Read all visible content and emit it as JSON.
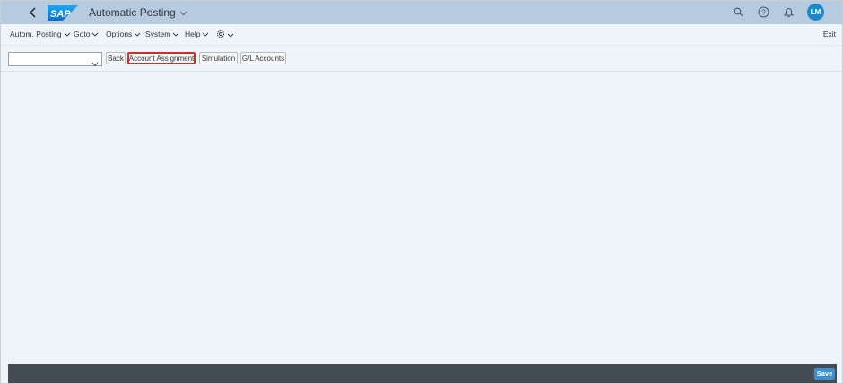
{
  "shell": {
    "logo_text": "SAP",
    "app_title": "Automatic Posting",
    "avatar_initials": "LM",
    "icons": [
      "back-icon",
      "search-icon",
      "help-icon",
      "bell-icon"
    ]
  },
  "menubar": {
    "items": [
      {
        "label": "Autom. Posting"
      },
      {
        "label": "Goto"
      },
      {
        "label": "Options"
      },
      {
        "label": "System"
      },
      {
        "label": "Help"
      }
    ],
    "settings_icon": "gear-icon",
    "exit_label": "Exit"
  },
  "toolbar": {
    "dropdown_value": "",
    "buttons": [
      {
        "label": "Back"
      },
      {
        "label": "Account Assignment",
        "highlighted": true
      },
      {
        "label": "Simulation"
      },
      {
        "label": "G/L Accounts"
      }
    ]
  },
  "footer": {
    "save_label": "Save"
  },
  "colors": {
    "shell_bg": "#b7cbe0",
    "page_bg": "#eff4f9",
    "footer_bg": "#434c55",
    "save_button": "#3e8fd1",
    "avatar": "#1b88c7",
    "highlight": "#d12c2c"
  }
}
